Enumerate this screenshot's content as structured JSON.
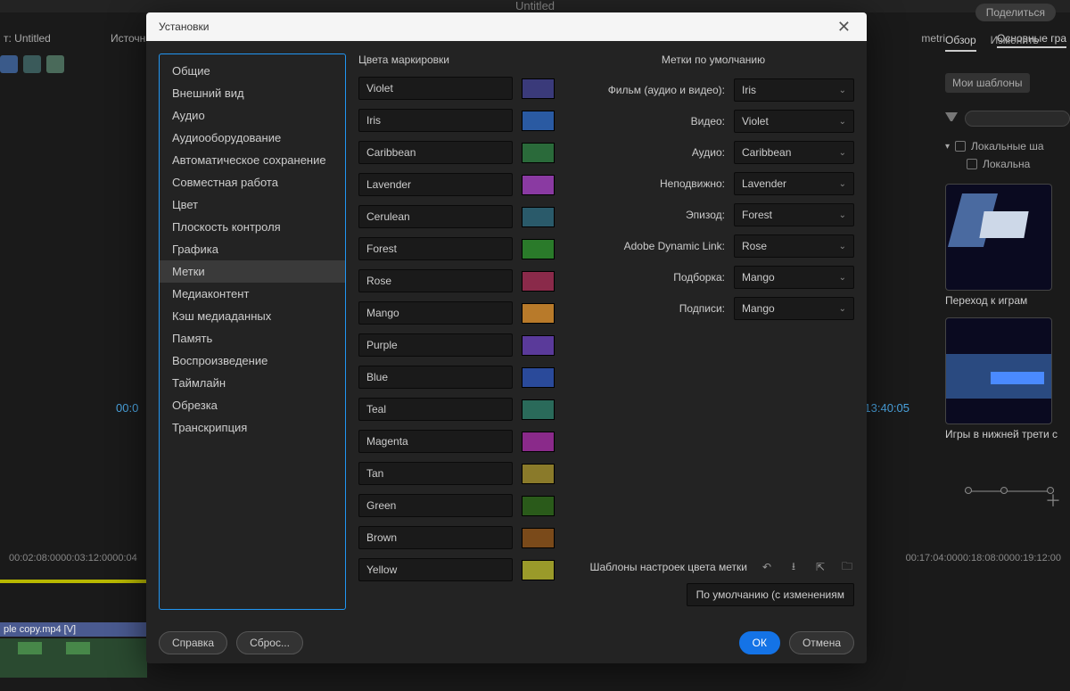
{
  "app": {
    "doc_title": "Untitled",
    "share": "Поделиться",
    "project_tab": "т: Untitled",
    "source_tab": "Источн",
    "metri": "metri",
    "timecode_left": "00:0",
    "timecode_right": "13:40:05",
    "ruler": [
      "00:02:08:00",
      "00:03:12:00",
      "00:04",
      "00:17:04:00",
      "00:18:08:00",
      "00:19:12:00"
    ],
    "clip_name": "ple copy.mp4 [V]"
  },
  "right": {
    "tabs": [
      "Обзор",
      "Изменить"
    ],
    "essentials_tab": "Основные гра",
    "templates_btn": "Мои шаблоны",
    "tree_root": "Локальные ша",
    "tree_child": "Локальна",
    "thumb1_label": "Переход к играм",
    "thumb2_label": "Игры в нижней трети с"
  },
  "modal": {
    "title": "Установки",
    "categories": [
      "Общие",
      "Внешний вид",
      "Аудио",
      "Аудиооборудование",
      "Автоматическое сохранение",
      "Совместная работа",
      "Цвет",
      "Плоскость контроля",
      "Графика",
      "Метки",
      "Медиаконтент",
      "Кэш медиаданных",
      "Память",
      "Воспроизведение",
      "Таймлайн",
      "Обрезка",
      "Транскрипция"
    ],
    "selected_category_index": 9,
    "col_colors_heading": "Цвета маркировки",
    "colors": [
      {
        "name": "Violet",
        "hex": "#3a3a7a"
      },
      {
        "name": "Iris",
        "hex": "#2a5aa2"
      },
      {
        "name": "Caribbean",
        "hex": "#2a6a3a"
      },
      {
        "name": "Lavender",
        "hex": "#8a3aa2"
      },
      {
        "name": "Cerulean",
        "hex": "#2a5a6a"
      },
      {
        "name": "Forest",
        "hex": "#2a7a2a"
      },
      {
        "name": "Rose",
        "hex": "#8a2a4a"
      },
      {
        "name": "Mango",
        "hex": "#b87a2a"
      },
      {
        "name": "Purple",
        "hex": "#5a3a9a"
      },
      {
        "name": "Blue",
        "hex": "#2a4a9a"
      },
      {
        "name": "Teal",
        "hex": "#2a6a5a"
      },
      {
        "name": "Magenta",
        "hex": "#8a2a8a"
      },
      {
        "name": "Tan",
        "hex": "#8a7a2a"
      },
      {
        "name": "Green",
        "hex": "#2a5a1a"
      },
      {
        "name": "Brown",
        "hex": "#7a4a1a"
      },
      {
        "name": "Yellow",
        "hex": "#9a9a2a"
      }
    ],
    "col_defaults_heading": "Метки по умолчанию",
    "defaults": [
      {
        "label": "Фильм (аудио и видео):",
        "value": "Iris"
      },
      {
        "label": "Видео:",
        "value": "Violet"
      },
      {
        "label": "Аудио:",
        "value": "Caribbean"
      },
      {
        "label": "Неподвижно:",
        "value": "Lavender"
      },
      {
        "label": "Эпизод:",
        "value": "Forest"
      },
      {
        "label": "Adobe Dynamic Link:",
        "value": "Rose"
      },
      {
        "label": "Подборка:",
        "value": "Mango"
      },
      {
        "label": "Подписи:",
        "value": "Mango"
      }
    ],
    "preset_label": "Шаблоны настроек цвета метки",
    "default_button": "По умолчанию (с изменениям",
    "footer": {
      "help": "Справка",
      "reset": "Сброс...",
      "ok": "ОК",
      "cancel": "Отмена"
    }
  }
}
